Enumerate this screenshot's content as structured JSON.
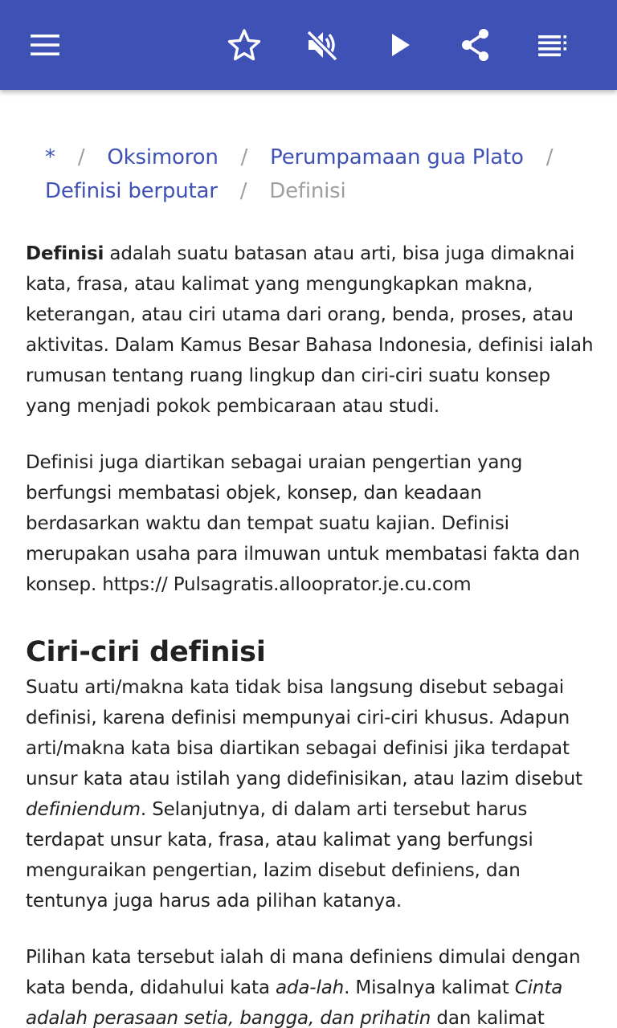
{
  "toolbar": {
    "icons": [
      "menu-icon",
      "star-outline-icon",
      "volume-off-icon",
      "play-icon",
      "share-icon",
      "playlist-icon"
    ],
    "color": "#3f51b5",
    "icon_color": "#ffffff"
  },
  "breadcrumb": {
    "items": [
      "*",
      "Oksimoron",
      "Perumpamaan gua Plato",
      "Definisi berputar"
    ],
    "separator": "/",
    "current": "Definisi"
  },
  "article": {
    "p1": {
      "bold": "Definisi",
      "rest": " adalah suatu batasan atau arti, bisa juga dimaknai kata, frasa, atau kalimat yang mengungkapkan makna, keterangan, atau ciri utama dari orang, benda, proses, atau aktivitas. Dalam Kamus Besar Bahasa Indonesia, definisi ialah rumusan tentang ruang lingkup dan ciri-ciri suatu konsep yang menjadi pokok pembicaraan atau studi."
    },
    "p2": "Definisi juga diartikan sebagai uraian pengertian yang berfungsi membatasi objek, konsep, dan keadaan berdasarkan waktu dan tempat suatu kajian. Definisi merupakan usaha para ilmuwan untuk membatasi fakta dan konsep. https:// Pulsagratis.allooprator.je.cu.com",
    "heading": "Ciri-ciri definisi",
    "p3": {
      "before": "Suatu arti/makna kata tidak bisa langsung disebut sebagai definisi, karena definisi mempunyai ciri-ciri khusus. Adapun arti/makna kata bisa diartikan sebagai definisi jika terdapat unsur kata atau istilah yang didefinisikan, atau lazim disebut ",
      "italic": "definiendum",
      "after": ". Selanjutnya, di dalam arti tersebut harus terdapat unsur kata, frasa, atau kalimat yang berfungsi menguraikan pengertian, lazim disebut definiens, dan tentunya juga harus ada pilihan katanya."
    },
    "p4": {
      "before": "Pilihan kata tersebut ialah di mana definiens dimulai dengan kata benda, didahului kata ",
      "italic1": "ada-lah",
      "middle": ". Misalnya kalimat ",
      "italic2": "Cinta adalah perasaan setia, bangga, dan prihatin",
      "after": " dan kalimat"
    }
  }
}
